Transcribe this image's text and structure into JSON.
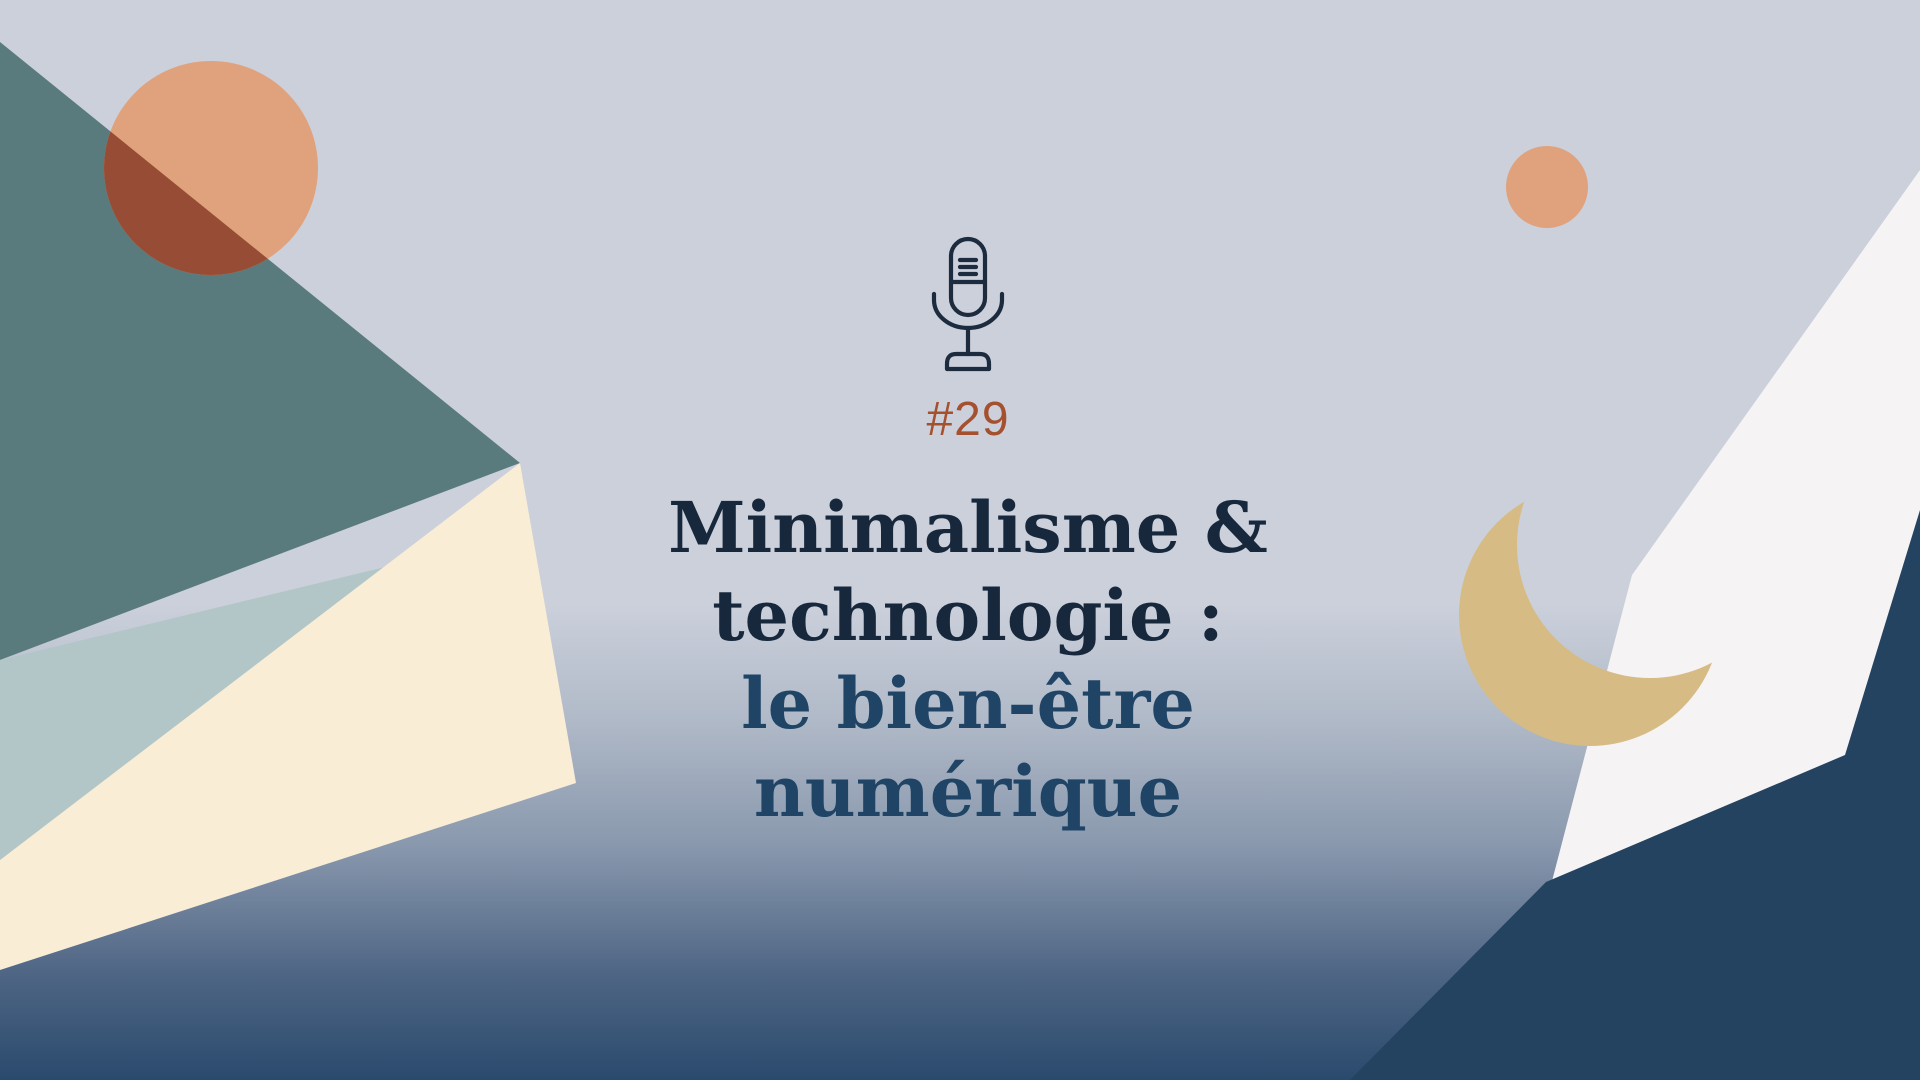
{
  "episode": {
    "number": "#29"
  },
  "title": {
    "line1": "Minimalisme &",
    "line2": "technologie  :",
    "line3": "le bien-être",
    "line4": "numérique"
  },
  "icons": {
    "microphone": "microphone-icon",
    "moon": "crescent-moon-icon"
  },
  "colors": {
    "title_dark": "#17283c",
    "title_blue": "#1f4466",
    "episode": "#a5502f",
    "teal": "#5a7b7e",
    "cream": "#f9edd6",
    "peach": "#e0a27c",
    "navy": "#244361",
    "gold": "#d7bb84"
  }
}
